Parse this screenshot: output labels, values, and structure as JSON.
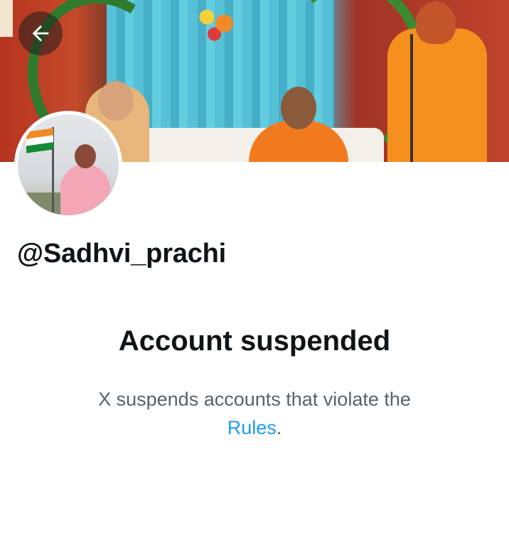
{
  "profile": {
    "handle": "@Sadhvi_prachi"
  },
  "suspension": {
    "title": "Account suspended",
    "message": "X suspends accounts that violate the",
    "link_text": "Rules",
    "trailing": "."
  },
  "icons": {
    "back": "arrow-left-icon"
  },
  "colors": {
    "text_primary": "#0f1419",
    "text_secondary": "#536471",
    "link": "#1d9bf0"
  }
}
